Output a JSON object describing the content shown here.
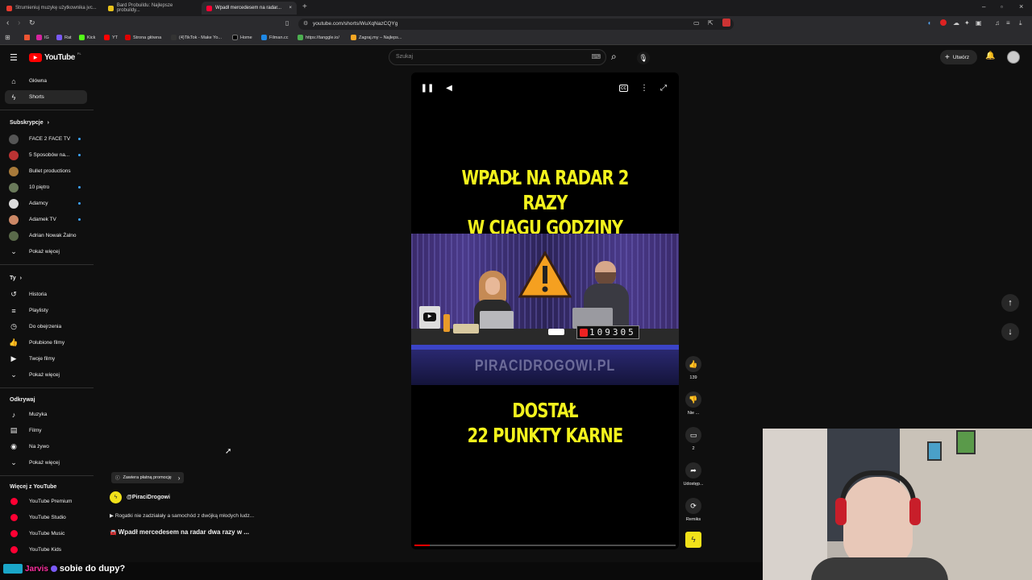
{
  "browser": {
    "tabs": [
      {
        "title": "Strumieniuj muzykę użytkownika jvc...",
        "icon_color": "#e63b2e"
      },
      {
        "title": "Bard Probuildu: Najlepsze probuildy...",
        "icon_color": "#e8c21a"
      },
      {
        "title": "Wpadł mercedesem na radar...",
        "icon_color": "#ff0033",
        "active": true
      }
    ],
    "new_tab": "+",
    "url": "youtube.com/shorts/WuXqNazCQYg",
    "bookmarks": [
      {
        "label": "IG",
        "color": "#d6249f"
      },
      {
        "label": "Rat",
        "color": "#7a5af8"
      },
      {
        "label": "Kick",
        "color": "#53fc18"
      },
      {
        "label": "YT",
        "color": "#ff0000"
      },
      {
        "label": "Strona główna",
        "color": "#d00"
      },
      {
        "label": "(4)TikTok - Make Yo...",
        "color": "#111"
      },
      {
        "label": "Home",
        "color": "#000"
      },
      {
        "label": "Filman.cc",
        "color": "#1e88e5"
      },
      {
        "label": "https://tanggle.io/",
        "color": "#4caf50"
      },
      {
        "label": "Zagraj.my – Najleps...",
        "color": "#f5a623"
      }
    ]
  },
  "youtube": {
    "logo": "YouTube",
    "logo_suffix": "PL",
    "search_placeholder": "Szukaj",
    "create_label": "Utwórz"
  },
  "sidebar": {
    "main": [
      {
        "label": "Główna",
        "icon": "home-icon",
        "glyph": "⌂"
      },
      {
        "label": "Shorts",
        "icon": "shorts-icon",
        "glyph": "ϟ",
        "active": true
      }
    ],
    "subs_header": "Subskrypcje",
    "subs": [
      {
        "label": "FACE 2 FACE TV",
        "color": "#555",
        "dot": true
      },
      {
        "label": "5 Sposobów na...",
        "color": "#b33",
        "dot": true
      },
      {
        "label": "Bullet productions",
        "color": "#a87a3a",
        "dot": false
      },
      {
        "label": "10 piętro",
        "color": "#6a7a5a",
        "dot": true
      },
      {
        "label": "Adamcy",
        "color": "#ddd",
        "dot": true
      },
      {
        "label": "Adamek TV",
        "color": "#c86",
        "dot": true
      },
      {
        "label": "Adrian Nowak Żalno",
        "color": "#5a6a4a",
        "dot": false
      }
    ],
    "subs_more": "Pokaż więcej",
    "you_header": "Ty",
    "you": [
      {
        "label": "Historia",
        "icon": "history-icon",
        "glyph": "↺"
      },
      {
        "label": "Playlisty",
        "icon": "playlist-icon",
        "glyph": "≡"
      },
      {
        "label": "Do obejrzenia",
        "icon": "clock-icon",
        "glyph": "◷"
      },
      {
        "label": "Polubione filmy",
        "icon": "thumb-up-icon",
        "glyph": "👍"
      },
      {
        "label": "Twoje filmy",
        "icon": "video-icon",
        "glyph": "▶"
      }
    ],
    "you_more": "Pokaż więcej",
    "explore_header": "Odkrywaj",
    "explore": [
      {
        "label": "Muzyka",
        "icon": "music-icon",
        "glyph": "♪"
      },
      {
        "label": "Filmy",
        "icon": "film-icon",
        "glyph": "▤"
      },
      {
        "label": "Na żywo",
        "icon": "live-icon",
        "glyph": "◉"
      }
    ],
    "explore_more": "Pokaż więcej",
    "more_header": "Więcej z YouTube",
    "more": [
      {
        "label": "YouTube Premium"
      },
      {
        "label": "YouTube Studio"
      },
      {
        "label": "YouTube Music"
      },
      {
        "label": "YouTube Kids"
      }
    ]
  },
  "short": {
    "caption_top": [
      "WPADŁ NA RADAR 2 RAZY",
      "W CIĄGU GODZINY"
    ],
    "caption_bottom": [
      "DOSTAŁ",
      "22 PUNKTY KARNE"
    ],
    "watermark": "PIRACIDROGOWI.PL",
    "counter": "109305",
    "progress_fraction": 0.06,
    "promo_label": "Zawiera płatną promocję",
    "channel": "@PiraciDrogowi",
    "related": "Rogatki nie zadziałały a samochód z dwójką młodych ludz...",
    "title": "Wpadł mercedesem na radar dwa razy w ..."
  },
  "actions": [
    {
      "icon": "like-icon",
      "glyph": "👍",
      "label": "139"
    },
    {
      "icon": "dislike-icon",
      "glyph": "👎",
      "label": "Nie ..."
    },
    {
      "icon": "comment-icon",
      "glyph": "▭",
      "label": "2"
    },
    {
      "icon": "share-icon",
      "glyph": "➦",
      "label": "Udostęp..."
    },
    {
      "icon": "remix-icon",
      "glyph": "⟳",
      "label": "Remiks"
    }
  ],
  "chat_overlay": {
    "name": "Jarvis",
    "text": "sobie do dupy?"
  }
}
